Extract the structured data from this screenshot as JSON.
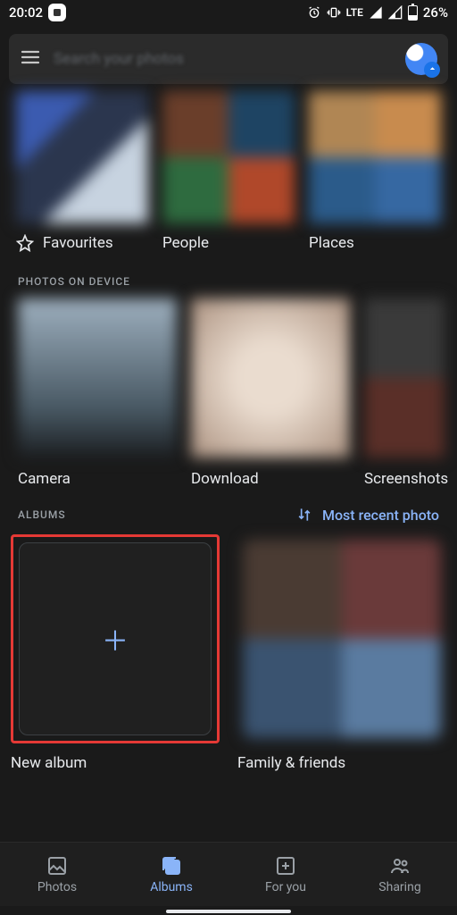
{
  "status": {
    "time": "20:02",
    "battery_pct": "26%",
    "network_label": "LTE"
  },
  "search": {
    "placeholder": "Search your photos"
  },
  "carousel": [
    {
      "label": "Favourites"
    },
    {
      "label": "People"
    },
    {
      "label": "Places"
    }
  ],
  "sections": {
    "on_device_title": "PHOTOS ON DEVICE",
    "albums_title": "ALBUMS"
  },
  "device_folders": [
    {
      "label": "Camera"
    },
    {
      "label": "Download"
    },
    {
      "label": "Screenshots"
    }
  ],
  "sort": {
    "label": "Most recent photo"
  },
  "albums": [
    {
      "label": "New album"
    },
    {
      "label": "Family & friends"
    }
  ],
  "nav": {
    "photos": "Photos",
    "albums": "Albums",
    "for_you": "For you",
    "sharing": "Sharing"
  }
}
